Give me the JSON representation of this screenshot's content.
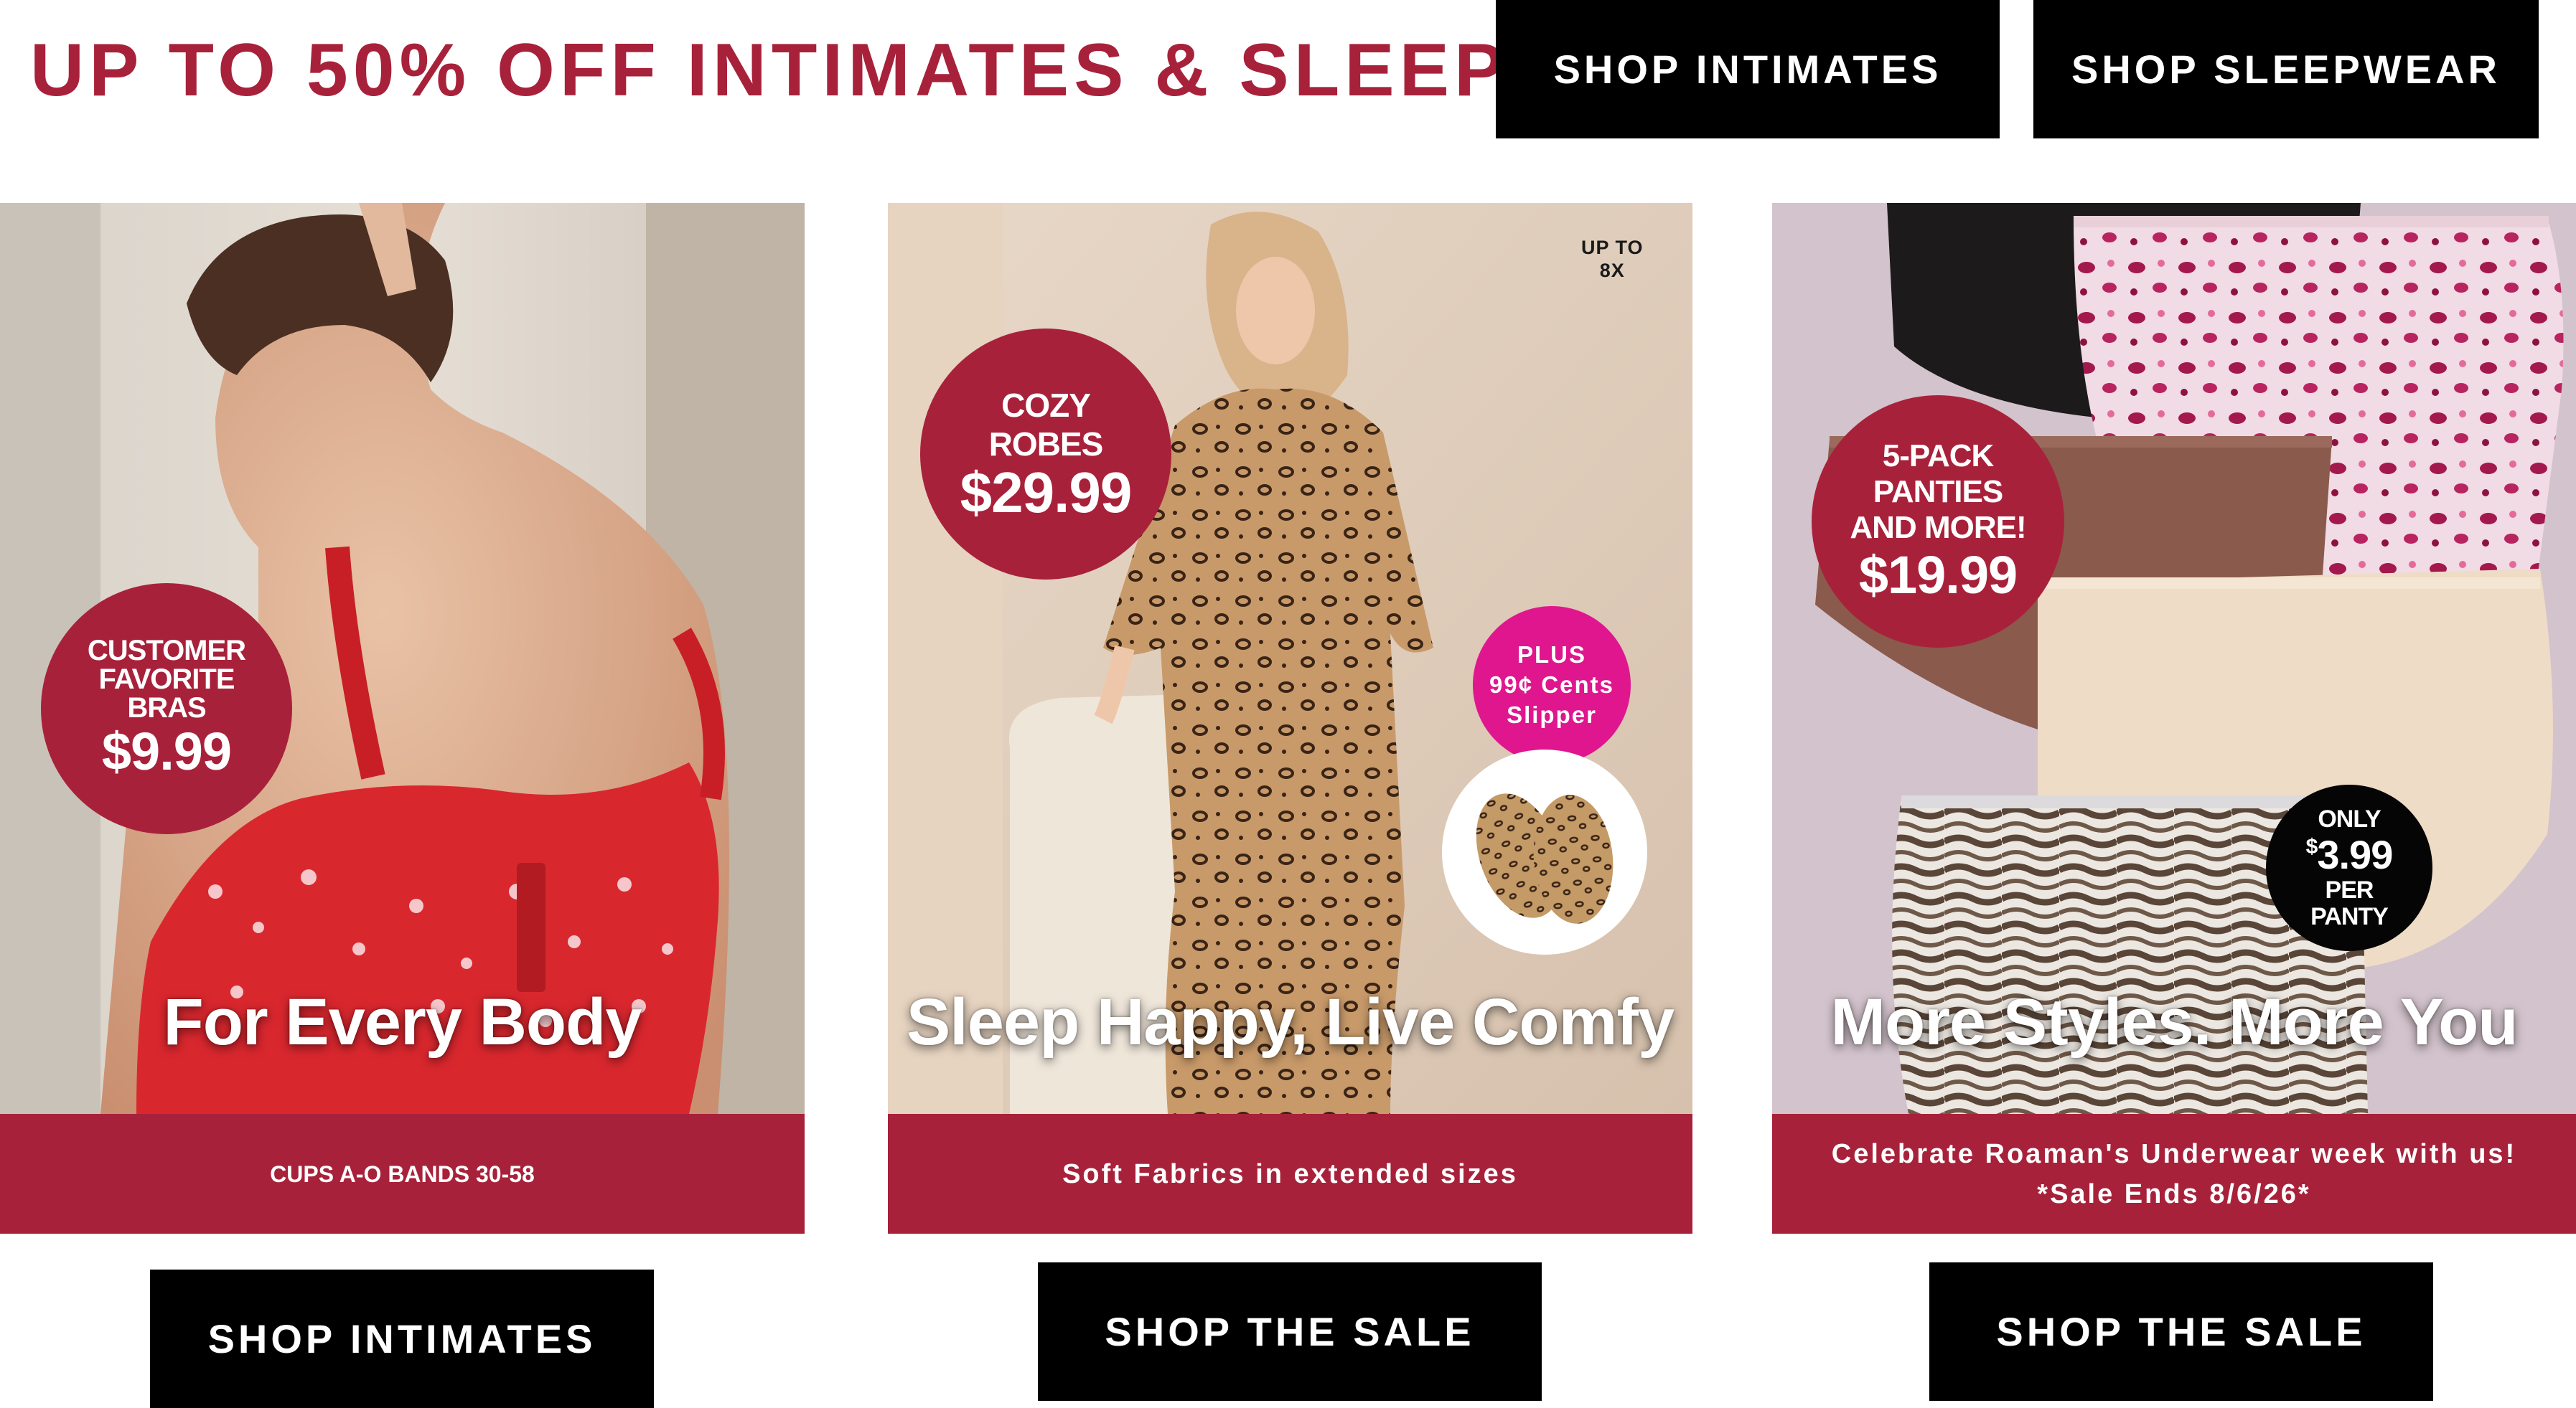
{
  "header": {
    "headline": "UP TO 50% OFF INTIMATES & SLEEP",
    "buttons": [
      "SHOP INTIMATES",
      "SHOP SLEEPWEAR"
    ]
  },
  "panels": [
    {
      "title": "For Every Body",
      "caption_lines": [
        "CUPS A-O BANDS 30-58"
      ],
      "badge": {
        "lines": [
          "CUSTOMER",
          "FAVORITE",
          "BRAS"
        ],
        "price": "$9.99"
      },
      "cta": "SHOP INTIMATES"
    },
    {
      "title": "Sleep Happy, Live Comfy",
      "caption_lines": [
        "Soft Fabrics in extended sizes"
      ],
      "size_note": [
        "UP TO",
        "8X"
      ],
      "badge": {
        "lines": [
          "COZY",
          "ROBES"
        ],
        "price": "$29.99"
      },
      "slipper_badge": [
        "PLUS",
        "99¢ Cents",
        "Slipper"
      ],
      "cta": "SHOP THE SALE"
    },
    {
      "title": "More Styles. More You",
      "caption_lines": [
        "Celebrate Roaman's Underwear week with us!",
        "*Sale Ends 8/6/26*"
      ],
      "badge": {
        "lines": [
          "5-PACK",
          "PANTIES",
          "AND MORE!"
        ],
        "price": "$19.99"
      },
      "only_badge": {
        "top": "ONLY",
        "currency": "$",
        "amount": "3.99",
        "bottom": [
          "PER",
          "PANTY"
        ]
      },
      "cta": "SHOP THE SALE"
    }
  ],
  "colors": {
    "accent": "#a8213a",
    "pink": "#e0168f",
    "black": "#000000"
  }
}
